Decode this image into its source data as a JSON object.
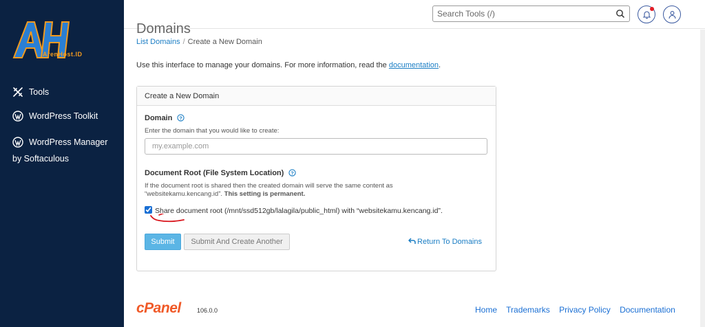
{
  "brand": {
    "logo_letters": "AH",
    "logo_text": "ArenHost.ID",
    "colors": {
      "logo_blue": "#2a7fd4",
      "logo_orange": "#f29a1e",
      "sidebar_bg": "#0b2242"
    }
  },
  "sidebar": {
    "items": [
      {
        "label": "Tools",
        "icon": "tools-icon"
      },
      {
        "label": "WordPress Toolkit",
        "icon": "wordpress-icon"
      },
      {
        "label": "WordPress Manager",
        "label2": "by Softaculous",
        "icon": "wordpress-icon"
      }
    ]
  },
  "header": {
    "search_placeholder": "Search Tools (/)",
    "search_icon": "search-icon",
    "bell_icon": "bell-icon",
    "user_icon": "user-icon"
  },
  "main": {
    "title_partial": "Domains",
    "breadcrumb": {
      "link": "List Domains",
      "separator": "/",
      "current": "Create a New Domain"
    },
    "intro_text": "Use this interface to manage your domains. For more information, read the ",
    "intro_link": "documentation",
    "intro_end": ".",
    "panel": {
      "title": "Create a New Domain",
      "domain_label": "Domain",
      "domain_desc": "Enter the domain that you would like to create:",
      "domain_placeholder": "my.example.com",
      "docroot_label": "Document Root (File System Location)",
      "docroot_desc_1": "If the document root is shared then the created domain will serve the same content as",
      "docroot_desc_2": "“websitekamu.kencang.id”. ",
      "docroot_desc_bold": "This setting is permanent.",
      "share_label": "Share document root (/mnt/ssd512gb/lalagila/public_html) with “websitekamu.kencang.id”.",
      "share_checked": true,
      "submit_label": "Submit",
      "submit_another_label": "Submit And Create Another",
      "return_label": "Return To Domains"
    }
  },
  "footer": {
    "logo": "cPanel",
    "version": "106.0.0",
    "links": [
      "Home",
      "Trademarks",
      "Privacy Policy",
      "Documentation"
    ]
  }
}
